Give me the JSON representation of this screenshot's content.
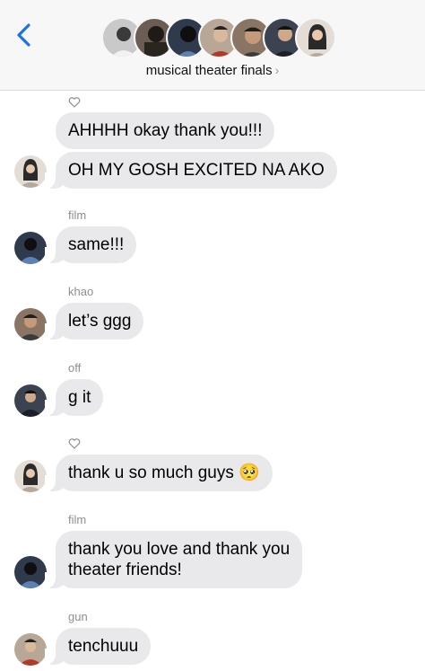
{
  "header": {
    "group_name": "musical theater finals",
    "chevron": "›",
    "back_icon": "chevron-left-icon",
    "member_count": 7
  },
  "messages": [
    {
      "text": "AHHHH okay thank you!!!",
      "liked": true
    },
    {
      "text": "OH MY GOSH EXCITED NA AKO"
    },
    {
      "sender": "film",
      "text": "same!!!"
    },
    {
      "sender": "khao",
      "text": "let’s ggg"
    },
    {
      "sender": "off",
      "text": "g it"
    },
    {
      "text": "thank u so much guys 🥺",
      "liked": true
    },
    {
      "sender": "film",
      "text_line1": "thank you love and thank you",
      "text_line2": "theater friends!"
    },
    {
      "sender": "gun",
      "text": "tenchuuu"
    }
  ],
  "colors": {
    "accent": "#1a73e8",
    "bubble": "#e9e9eb",
    "sender_label": "#8e8e93",
    "header_bg": "#f7f7f7"
  }
}
